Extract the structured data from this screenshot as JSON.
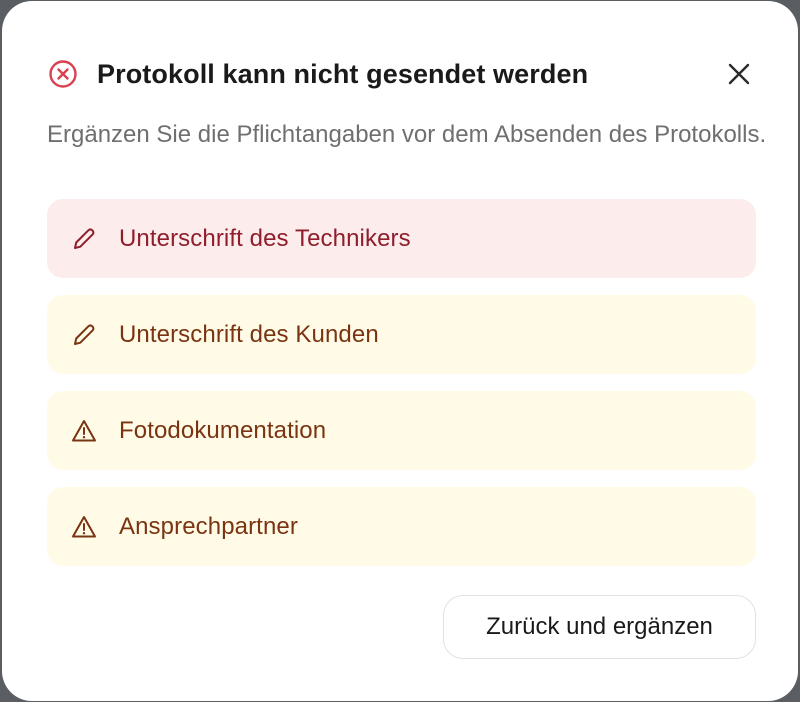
{
  "dialog": {
    "title": "Protokoll kann nicht gesendet werden",
    "title_icon": "error-circle-x-icon",
    "close_icon": "close-icon",
    "description": "Ergänzen Sie die Pflichtangaben vor dem Absenden des Protokolls.",
    "items": [
      {
        "label": "Unterschrift des Technikers",
        "icon": "pen-icon",
        "severity": "error"
      },
      {
        "label": "Unterschrift des Kunden",
        "icon": "pen-icon",
        "severity": "warning"
      },
      {
        "label": "Fotodokumentation",
        "icon": "warning-triangle-icon",
        "severity": "warning"
      },
      {
        "label": "Ansprechpartner",
        "icon": "warning-triangle-icon",
        "severity": "warning"
      }
    ],
    "back_button_label": "Zurück und ergänzen"
  },
  "colors": {
    "error_icon": "#d9414f",
    "error_background": "#fdecec",
    "error_text": "#8f1d2c",
    "warning_background": "#fffbe6",
    "warning_text": "#7a3412"
  }
}
